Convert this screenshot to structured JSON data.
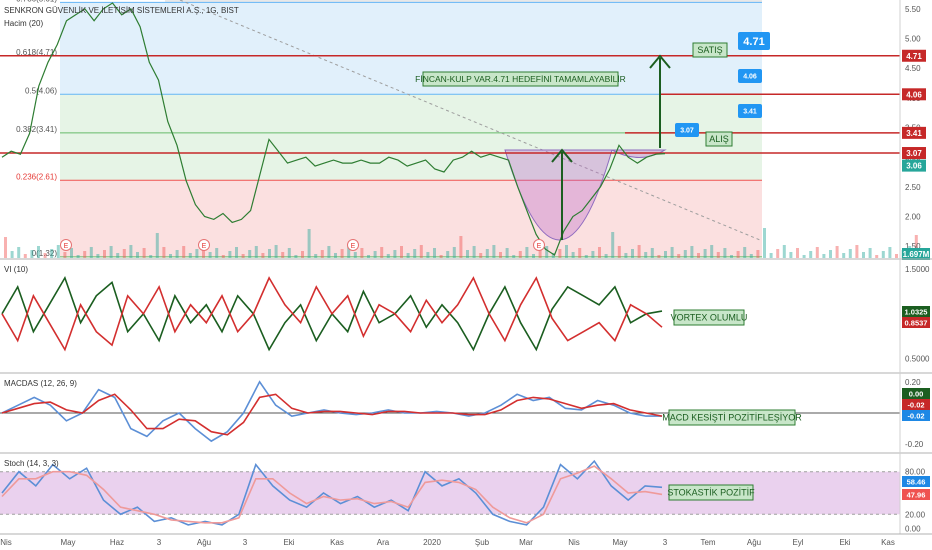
{
  "header": {
    "symbol_title": "SENKRON GÜVENLİK VE İLETİŞİM SİSTEMLERİ A.Ş., 1G, BIST",
    "volume_label": "Hacim (20)"
  },
  "chart_data": [
    {
      "type": "line",
      "panel": "price",
      "ylim": [
        1.3,
        5.65
      ],
      "y_ticks": [
        "5.50",
        "5.00",
        "4.50",
        "4.00",
        "3.50",
        "3.00",
        "2.50",
        "2.00",
        "1.50"
      ],
      "x_labels": [
        "Nis",
        "May",
        "Haz",
        "3",
        "Ağu",
        "3",
        "Eki",
        "Kas",
        "Ara",
        "2020",
        "Şub",
        "Mar",
        "Nis",
        "May",
        "3",
        "Tem",
        "Ağu",
        "Eyl",
        "Eki",
        "Kas"
      ],
      "fib_levels": [
        {
          "label": "0.786(5.61)",
          "value": 5.61
        },
        {
          "label": "0.618(4.71)",
          "value": 4.71
        },
        {
          "label": "0.5(4.06)",
          "value": 4.06
        },
        {
          "label": "0.382(3.41)",
          "value": 3.41
        },
        {
          "label": "0.236(2.61)",
          "value": 2.61
        },
        {
          "label": "0(1.32)",
          "value": 1.32
        }
      ],
      "horizontal_lines": [
        {
          "value": 4.71,
          "label": "4.71",
          "color": "#c62828"
        },
        {
          "value": 4.06,
          "label": "4.06",
          "color": "#c62828"
        },
        {
          "value": 3.41,
          "label": "3.41",
          "color": "#c62828"
        },
        {
          "value": 3.07,
          "label": "3.07",
          "color": "#c62828"
        }
      ],
      "last_price": {
        "label": "3.06",
        "value": 3.06
      },
      "volume_badge": "1.697M",
      "callouts": [
        "4.71",
        "4.06",
        "3.41",
        "3.07"
      ],
      "annotations": {
        "satis": "SATIŞ",
        "alis": "ALIŞ",
        "pattern": "FİNCAN-KULP VAR.4.71 HEDEFİNİ TAMAMLAYABİLİR",
        "event_marker": "E"
      },
      "series": [
        {
          "values": [
            3.0,
            3.1,
            3.05,
            3.4,
            4.2,
            4.6,
            4.9,
            5.3,
            5.4,
            5.5,
            5.3,
            5.5,
            5.6,
            5.4,
            5.5,
            5.2,
            4.6,
            4.3,
            3.6,
            3.2,
            2.6,
            2.2,
            2.0,
            1.95,
            2.05,
            1.9,
            1.95,
            2.1,
            2.7,
            3.3,
            3.1,
            2.9,
            2.95,
            3.0,
            2.85,
            2.9,
            2.95,
            2.9,
            2.9,
            2.95,
            2.9,
            2.9,
            3.0,
            2.95,
            2.85,
            2.9,
            2.95,
            2.8,
            2.75,
            2.95,
            3.0,
            3.1,
            3.0,
            3.05,
            3.0,
            2.95,
            2.5,
            2.1,
            1.7,
            1.45,
            1.35,
            1.75,
            2.0,
            2.1,
            2.3,
            2.5,
            2.8,
            3.2,
            3.0,
            2.9,
            3.0,
            3.05,
            3.06
          ]
        }
      ]
    },
    {
      "type": "line",
      "panel": "vortex",
      "title": "VI (10)",
      "ylim": [
        0.35,
        1.6
      ],
      "y_ticks": [
        "1.5000",
        "1.0000",
        "0.5000"
      ],
      "last_values": [
        "1.0325",
        "0.8537"
      ],
      "annotation": "VORTEX OLUMLU",
      "series": [
        {
          "values": [
            1.0,
            1.3,
            0.8,
            1.1,
            1.4,
            0.9,
            1.2,
            1.35,
            0.8,
            1.0,
            0.7,
            1.2,
            0.9,
            1.1,
            0.8,
            1.2,
            1.0,
            0.6,
            0.9,
            1.1,
            0.7,
            1.0,
            0.8,
            1.25,
            0.9,
            1.0,
            1.2,
            0.85,
            1.1,
            0.9,
            0.6,
            1.0,
            1.3,
            0.9,
            0.6,
            1.05,
            1.3,
            1.2,
            1.1,
            1.3,
            0.9,
            1.0,
            1.03
          ]
        },
        {
          "values": [
            1.0,
            0.7,
            1.2,
            0.9,
            0.6,
            1.1,
            0.8,
            0.65,
            1.2,
            1.0,
            1.3,
            0.8,
            1.1,
            0.9,
            1.2,
            0.8,
            1.0,
            1.4,
            1.1,
            0.9,
            1.3,
            1.0,
            1.2,
            0.75,
            1.1,
            1.0,
            0.8,
            1.15,
            0.9,
            1.1,
            1.4,
            1.0,
            0.7,
            1.1,
            1.4,
            0.95,
            0.7,
            0.8,
            0.9,
            0.7,
            1.1,
            1.0,
            0.85
          ]
        }
      ]
    },
    {
      "type": "line",
      "panel": "macd",
      "title": "MACDAS (12, 26, 9)",
      "ylim": [
        -0.25,
        0.25
      ],
      "y_ticks": [
        "0.20",
        "0.00",
        "-0.20"
      ],
      "last_values": [
        "0.00",
        "-0.02",
        "-0.02"
      ],
      "annotation": "MACD KESİŞTİ POZİTİFLEŞİYOR",
      "series": [
        {
          "values": [
            0.0,
            0.05,
            0.1,
            0.05,
            -0.05,
            0.0,
            0.15,
            0.1,
            -0.1,
            -0.15,
            -0.05,
            0.0,
            -0.1,
            -0.18,
            -0.12,
            0.0,
            0.2,
            0.05,
            -0.02,
            0.0,
            0.02,
            0.0,
            -0.01,
            0.0,
            0.02,
            0.0,
            0.0,
            0.01,
            0.0,
            -0.02,
            0.0,
            0.05,
            0.12,
            0.08,
            0.1,
            0.03,
            0.02,
            0.08,
            0.05,
            0.0,
            -0.02,
            -0.02
          ]
        },
        {
          "values": [
            0.0,
            0.03,
            0.06,
            0.07,
            0.02,
            0.0,
            0.08,
            0.12,
            0.02,
            -0.1,
            -0.1,
            -0.04,
            -0.05,
            -0.12,
            -0.14,
            -0.06,
            0.1,
            0.12,
            0.03,
            0.0,
            0.01,
            0.01,
            0.0,
            -0.01,
            0.01,
            0.01,
            0.0,
            0.0,
            0.0,
            -0.01,
            -0.01,
            0.02,
            0.08,
            0.1,
            0.09,
            0.06,
            0.03,
            0.05,
            0.06,
            0.02,
            0.0,
            -0.02
          ]
        }
      ]
    },
    {
      "type": "line",
      "panel": "stoch",
      "title": "Stoch (14, 3, 3)",
      "ylim": [
        -5,
        105
      ],
      "y_ticks": [
        "80.00",
        "20.00",
        "0.00"
      ],
      "last_values": [
        "58.46",
        "47.96"
      ],
      "annotation": "STOKASTİK POZİTİF",
      "series": [
        {
          "values": [
            50,
            80,
            60,
            90,
            70,
            85,
            40,
            20,
            30,
            10,
            15,
            5,
            10,
            5,
            20,
            90,
            60,
            40,
            30,
            50,
            35,
            45,
            30,
            40,
            25,
            80,
            60,
            70,
            50,
            20,
            10,
            5,
            30,
            90,
            70,
            95,
            60,
            40,
            60,
            58
          ]
        },
        {
          "values": [
            45,
            70,
            70,
            80,
            80,
            75,
            55,
            30,
            25,
            20,
            12,
            10,
            8,
            8,
            15,
            70,
            70,
            50,
            35,
            45,
            40,
            42,
            35,
            38,
            30,
            65,
            68,
            65,
            55,
            30,
            15,
            8,
            20,
            70,
            78,
            88,
            70,
            50,
            52,
            48
          ]
        }
      ]
    }
  ]
}
